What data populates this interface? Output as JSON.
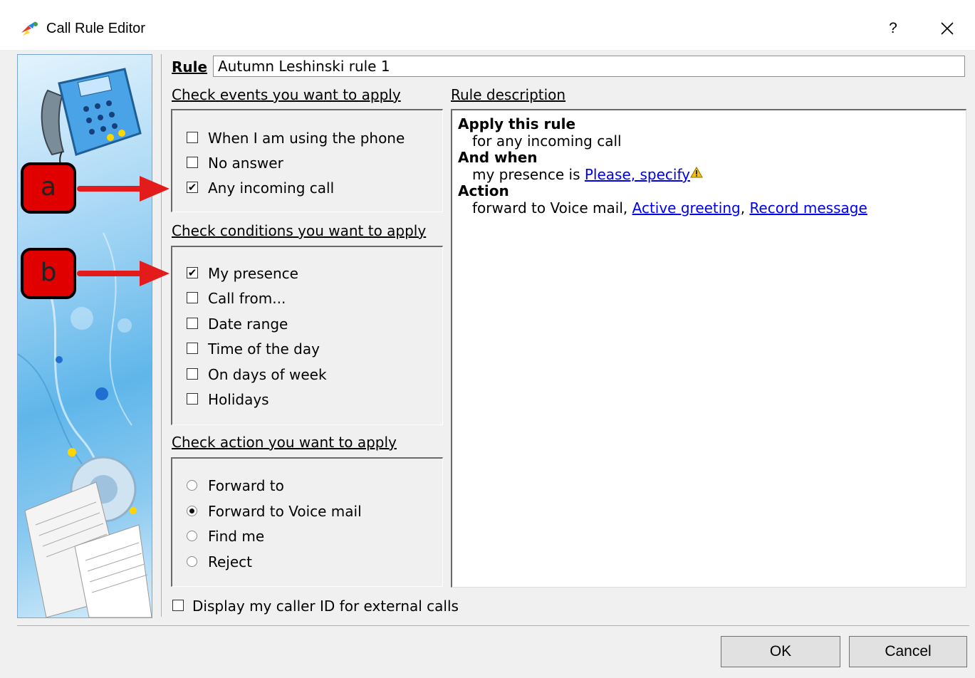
{
  "window": {
    "title": "Call Rule Editor",
    "help_label": "?",
    "close_label": "✕"
  },
  "rule": {
    "label": "Rule",
    "value": "Autumn Leshinski rule 1"
  },
  "events": {
    "header": "Check events you want to apply",
    "items": [
      {
        "label": "When I am using the phone",
        "checked": false
      },
      {
        "label": "No answer",
        "checked": false
      },
      {
        "label": "Any incoming call",
        "checked": true
      }
    ]
  },
  "conditions": {
    "header": "Check conditions you want to apply",
    "items": [
      {
        "label": "My presence",
        "checked": true
      },
      {
        "label": "Call from...",
        "checked": false
      },
      {
        "label": "Date range",
        "checked": false
      },
      {
        "label": "Time of the day",
        "checked": false
      },
      {
        "label": "On days of week",
        "checked": false
      },
      {
        "label": "Holidays",
        "checked": false
      }
    ]
  },
  "actions": {
    "header": "Check action you want to apply",
    "items": [
      {
        "label": "Forward to",
        "selected": false
      },
      {
        "label": "Forward to Voice mail",
        "selected": true
      },
      {
        "label": "Find me",
        "selected": false
      },
      {
        "label": "Reject",
        "selected": false
      }
    ]
  },
  "description": {
    "header": "Rule description",
    "apply_heading": "Apply this rule",
    "apply_text": "for any incoming call",
    "when_heading": "And when",
    "when_text": "my presence is",
    "when_link": "Please, specify",
    "action_heading": "Action",
    "action_text": "forward to Voice mail,",
    "action_link1": "Active greeting",
    "action_sep": ",",
    "action_link2": "Record message"
  },
  "caller_id": {
    "label": "Display my caller ID for external calls",
    "checked": false
  },
  "buttons": {
    "ok": "OK",
    "cancel": "Cancel"
  },
  "annotations": {
    "a": "a",
    "b": "b"
  },
  "colors": {
    "link": "#0000ee",
    "annotation_red": "#e00000",
    "arrow_red": "#e31b1b"
  }
}
